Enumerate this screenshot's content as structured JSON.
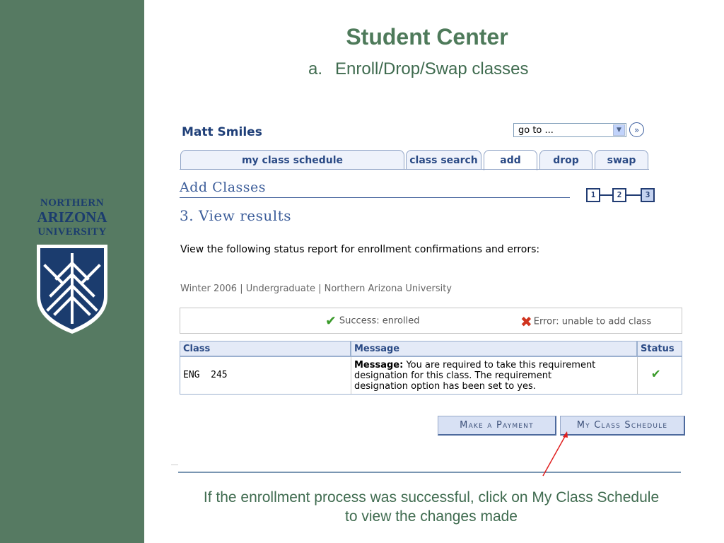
{
  "slide": {
    "title": "Student Center",
    "subtitle_marker": "a.",
    "subtitle": "Enroll/Drop/Swap classes",
    "caption_line1": "If the enrollment process was successful, click on My Class Schedule",
    "caption_line2": "to view the changes made"
  },
  "logo": {
    "line1": "NORTHERN",
    "line2": "ARIZONA",
    "line3": "UNIVERSITY"
  },
  "header": {
    "student_name": "Matt Smiles",
    "goto_label": "go to ..."
  },
  "tabs": [
    {
      "label": "my class schedule",
      "active": false
    },
    {
      "label": "class search",
      "active": false
    },
    {
      "label": "add",
      "active": true
    },
    {
      "label": "drop",
      "active": false
    },
    {
      "label": "swap",
      "active": false
    }
  ],
  "page": {
    "section_title": "Add Classes",
    "steps": [
      "1",
      "2",
      "3"
    ],
    "current_step": "3",
    "step_title": "3. View results",
    "intro": "View the following status report for enrollment confirmations and errors:",
    "term_line": "Winter 2006 | Undergraduate | Northern Arizona University"
  },
  "legend": {
    "success": "Success: enrolled",
    "error": "Error: unable to add class"
  },
  "table": {
    "headers": [
      "Class",
      "Message",
      "Status"
    ],
    "rows": [
      {
        "class": "ENG  245",
        "message_label": "Message:",
        "message_line1": "You are required to take this requirement",
        "message_line2": "designation for this class. The requirement",
        "message_line3": "designation option has been set to yes.",
        "status": "success"
      }
    ]
  },
  "buttons": {
    "make_payment": "Make a Payment",
    "my_class_schedule": "My Class Schedule"
  },
  "colors": {
    "sidebar": "#567a62",
    "title_green": "#4e7a5a",
    "ps_blue": "#2a4a85",
    "success": "#3b9b2b",
    "error": "#d0341f",
    "callout": "#e02020"
  }
}
